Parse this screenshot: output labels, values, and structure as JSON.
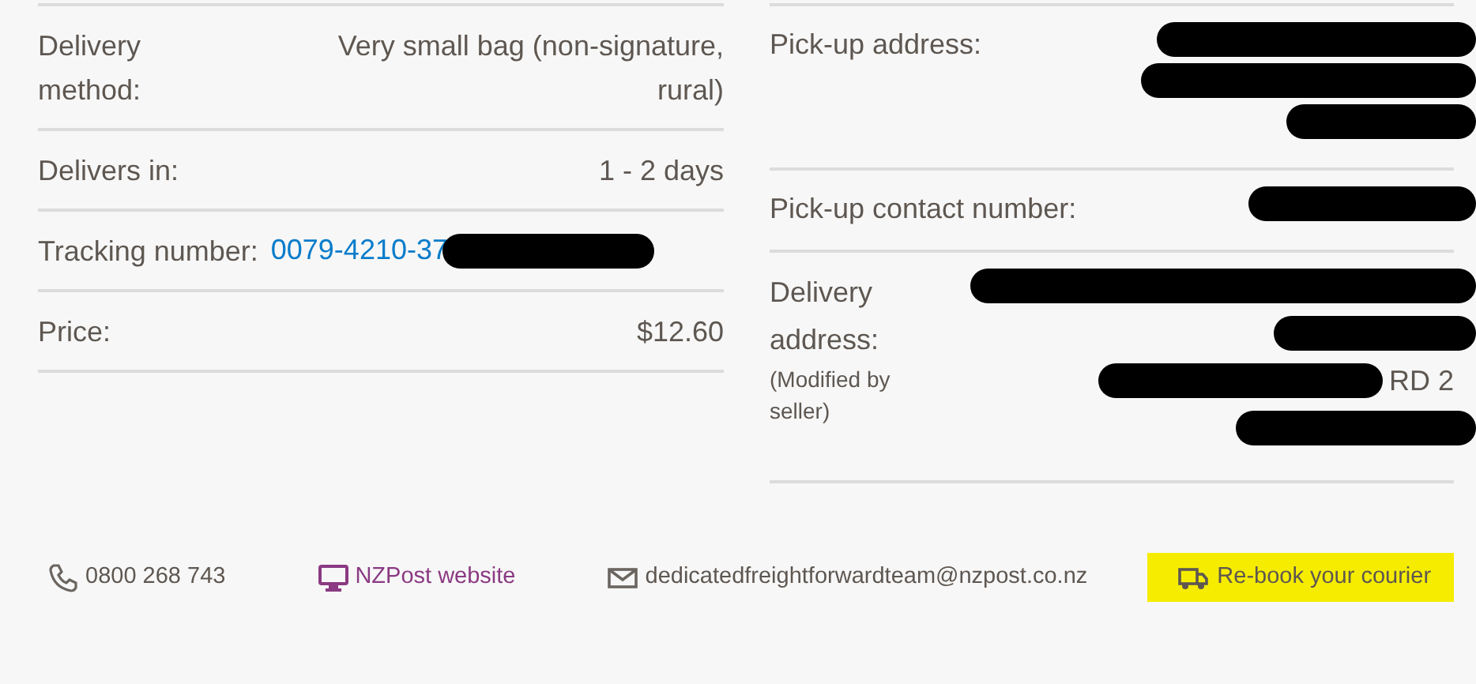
{
  "left_details": [
    {
      "label": "Delivery method:",
      "value": "Very small bag (non-signature, rural)",
      "kind": "text"
    },
    {
      "label": "Delivers in:",
      "value": "1 - 2 days",
      "kind": "text"
    },
    {
      "label": "Tracking number:",
      "value": "0079-4210-37",
      "kind": "link_redacted"
    },
    {
      "label": "Price:",
      "value": "$12.60",
      "kind": "text"
    }
  ],
  "right_details": [
    {
      "label": "Pick-up address:",
      "lines": [
        {
          "kind": "redacted"
        },
        {
          "kind": "redacted"
        },
        {
          "kind": "redacted"
        }
      ]
    },
    {
      "label": "Pick-up contact number:",
      "lines": [
        {
          "kind": "redacted"
        }
      ]
    },
    {
      "label": "Delivery address:",
      "note": "(Modified by seller)",
      "lines": [
        {
          "kind": "redacted"
        },
        {
          "kind": "redacted"
        },
        {
          "kind": "redacted_then_text",
          "text": "RD 2"
        },
        {
          "kind": "redacted"
        }
      ]
    }
  ],
  "footer": [
    {
      "kind": "phone",
      "text": "0800 268 743"
    },
    {
      "kind": "website",
      "text": "NZPost website"
    },
    {
      "kind": "email",
      "text": "dedicatedfreightforwardteam@nzpost.co.nz"
    },
    {
      "kind": "rebook",
      "text": "Re-book your courier"
    }
  ]
}
